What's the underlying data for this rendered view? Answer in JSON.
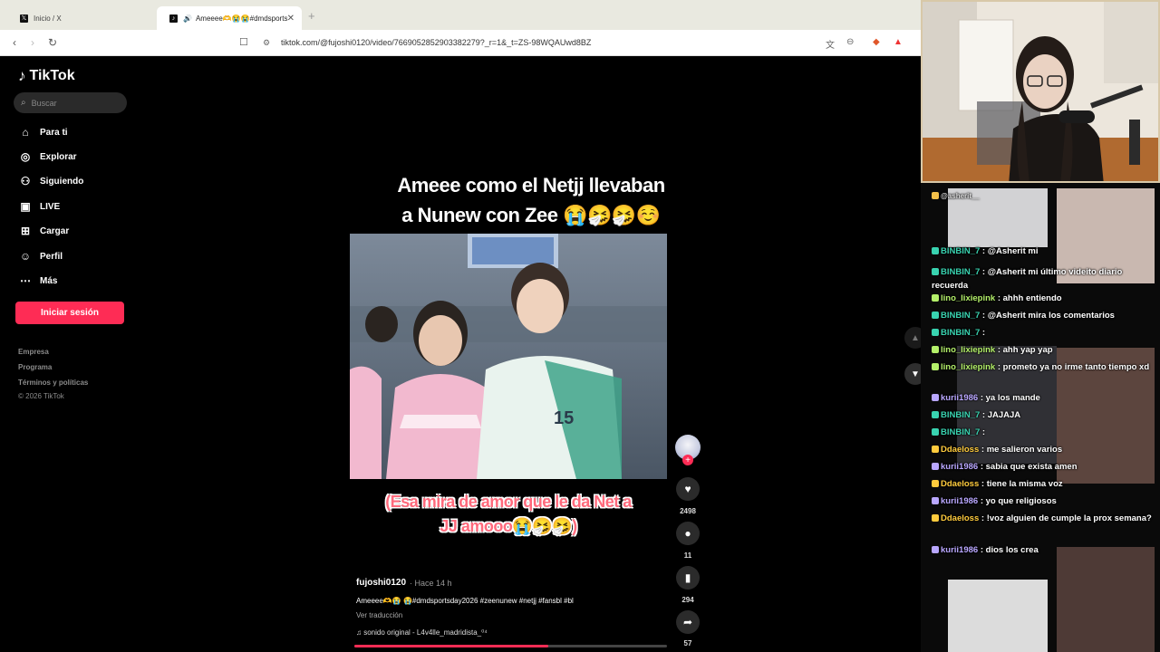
{
  "browser": {
    "tabs": [
      {
        "label": "Inicio / X",
        "active": false
      },
      {
        "label": "Ameeee🫶😭😭#dmdsports",
        "active": true
      }
    ],
    "url": "tiktok.com/@fujoshi0120/video/7669052852903382279?_r=1&_t=ZS-98WQAUwd8BZ"
  },
  "sidebar": {
    "logo": "TikTok",
    "search_placeholder": "Buscar",
    "items": [
      {
        "label": "Para ti",
        "icon": "home-icon"
      },
      {
        "label": "Explorar",
        "icon": "compass-icon"
      },
      {
        "label": "Siguiendo",
        "icon": "following-icon"
      },
      {
        "label": "LIVE",
        "icon": "live-icon"
      },
      {
        "label": "Cargar",
        "icon": "upload-icon"
      },
      {
        "label": "Perfil",
        "icon": "profile-icon"
      },
      {
        "label": "Más",
        "icon": "more-icon"
      }
    ],
    "login_label": "Iniciar sesión",
    "footer": [
      "Empresa",
      "Programa",
      "Términos y políticas",
      "© 2026 TikTok"
    ]
  },
  "video": {
    "caption_top_1": "Ameee como el Netjj llevaban",
    "caption_top_2": "a Nunew con Zee 😭🤧🤧☺️",
    "caption_bottom_1": "(Esa mira de amor que le da Net a",
    "caption_bottom_2": "JJ amooo😭🤧🤧)",
    "author": "fujoshi0120",
    "posted": "· Hace 14 h",
    "description": "Ameeee🫶😭 😭#dmdsportsday2026 #zeenunew #netjj #fansbl #bl",
    "translate": "Ver traducción",
    "sound": "sonido original - L4v4lle_madridista_⁰⁴",
    "progress": 0.62
  },
  "actions": {
    "likes": "2498",
    "comments": "11",
    "saves": "294",
    "shares": "57"
  },
  "chat": [
    {
      "user": "BINBIN_7",
      "text": ": @Asherit mi",
      "color": "#39d3b0"
    },
    {
      "user": "BINBIN_7",
      "text": ": @Asherit mi último videito diario recuerda",
      "color": "#39d3b0"
    },
    {
      "user": "lino_lixiepink",
      "text": ": ahhh entiendo",
      "color": "#b4f06a"
    },
    {
      "user": "BINBIN_7",
      "text": ": @Asherit mira los comentarios",
      "color": "#39d3b0"
    },
    {
      "user": "BINBIN_7",
      "text": ":",
      "color": "#39d3b0"
    },
    {
      "user": "lino_lixiepink",
      "text": ": ahh yap yap",
      "color": "#b4f06a"
    },
    {
      "user": "lino_lixiepink",
      "text": ": prometo ya no irme tanto tiempo xd",
      "color": "#b4f06a"
    },
    {
      "user": "kurii1986",
      "text": ": ya los mande",
      "color": "#b9a7ff"
    },
    {
      "user": "BINBIN_7",
      "text": ": JAJAJA",
      "color": "#39d3b0"
    },
    {
      "user": "BINBIN_7",
      "text": ":",
      "color": "#39d3b0"
    },
    {
      "user": "Ddaeloss",
      "text": ": me salieron varios",
      "color": "#ffcb3d"
    },
    {
      "user": "kurii1986",
      "text": ": sabia que exista amen",
      "color": "#b9a7ff"
    },
    {
      "user": "Ddaeloss",
      "text": ": tiene la misma voz",
      "color": "#ffcb3d"
    },
    {
      "user": "kurii1986",
      "text": ": yo que religiosos",
      "color": "#b9a7ff"
    },
    {
      "user": "Ddaeloss",
      "text": ": !voz alguien de cumple la prox semana?",
      "color": "#ffcb3d"
    },
    {
      "user": "kurii1986",
      "text": ": dios los crea",
      "color": "#b9a7ff"
    }
  ],
  "chat_header": "@asherit__",
  "colors": {
    "accent": "#fe2c55"
  }
}
